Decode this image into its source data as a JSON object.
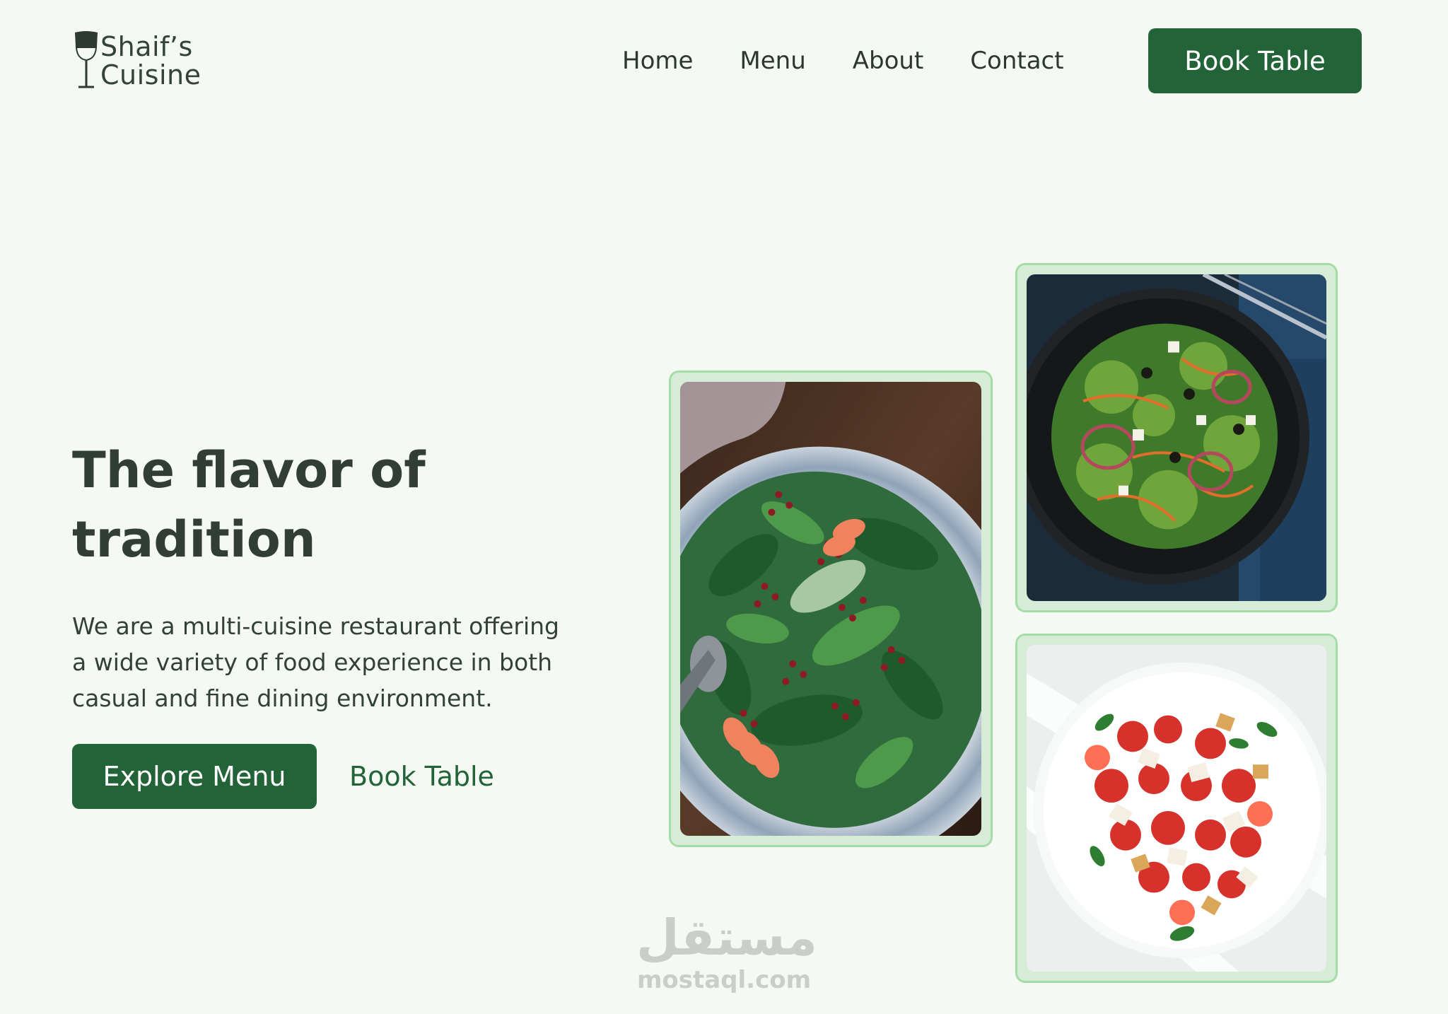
{
  "brand": {
    "line1": "Shaif’s",
    "line2": "Cuisine",
    "icon": "wine-glass-icon"
  },
  "nav": {
    "items": [
      {
        "label": "Home"
      },
      {
        "label": "Menu"
      },
      {
        "label": "About"
      },
      {
        "label": "Contact"
      }
    ],
    "cta_label": "Book Table"
  },
  "hero": {
    "title_line1": "The flavor of",
    "title_line2": "tradition",
    "description": "We are a multi-cuisine restaurant offering a wide variety of food experience in both casual and fine dining environment.",
    "primary_button": "Explore Menu",
    "secondary_link": "Book Table"
  },
  "gallery": {
    "images": [
      {
        "subject": "spinach-pomegranate-salad"
      },
      {
        "subject": "greek-salad-dark-bowl"
      },
      {
        "subject": "caprese-salad-white-plate"
      }
    ]
  },
  "watermark": {
    "logo": "مستقل",
    "url": "mostaql.com"
  },
  "colors": {
    "background": "#f4f9f3",
    "accent": "#236338",
    "text": "#2f3a33",
    "card_border": "#a6dca5"
  }
}
